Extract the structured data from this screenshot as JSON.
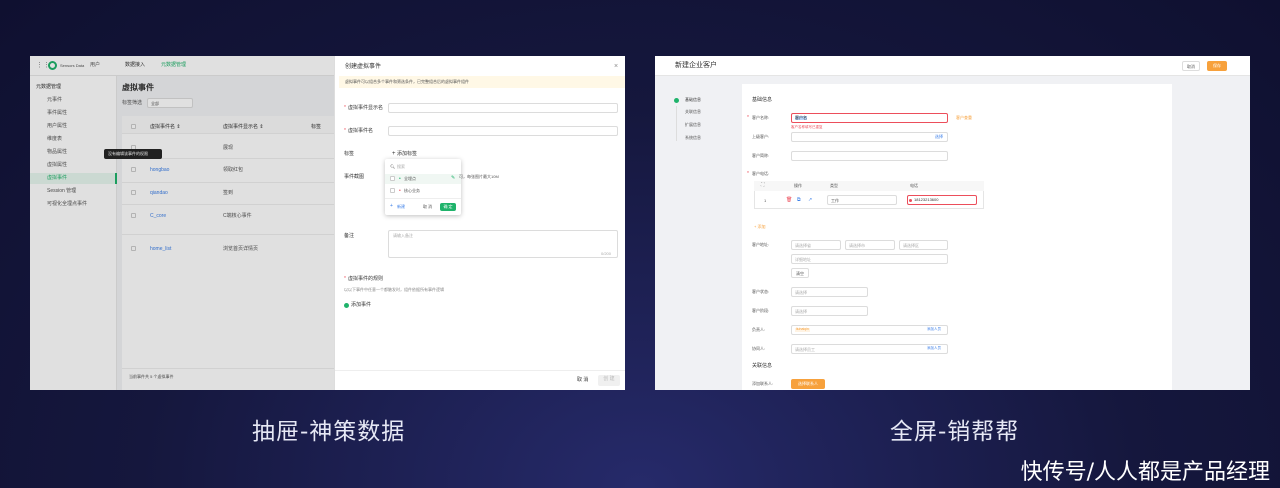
{
  "left": {
    "logo_brand": "Sensors Data",
    "top_menu": "用户",
    "nav_tabs": [
      "数据接入",
      "元数据管理"
    ],
    "sidebar_section": "元数据管理",
    "sidebar_items": [
      "元事件",
      "事件属性",
      "用户属性",
      "维度表",
      "物品属性",
      "虚拟属性",
      "虚拟事件",
      "Session 管理",
      "可视化全埋点事件"
    ],
    "page_title": "虚拟事件",
    "filter_label": "标签筛选",
    "filter_value": "全部",
    "columns": [
      "虚拟事件名 ⇕",
      "虚拟事件显示名 ⇕",
      "标签"
    ],
    "rows": [
      {
        "name": "",
        "display": "展现"
      },
      {
        "name": "hongbao",
        "display": "领取红包"
      },
      {
        "name": "qiandao",
        "display": "签到"
      },
      {
        "name": "C_core",
        "display": "C端核心事件"
      },
      {
        "name": "home_list",
        "display": "浏览首页详情页"
      }
    ],
    "tooltip": "没有编辑该事件的权限",
    "footer": "当前事件共 5 个虚拟事件",
    "drawer": {
      "title": "创建虚拟事件",
      "notice": "虚拟事件可以组合多个事件和筛选条件，已完整组合后的虚拟事件组件",
      "f1_label": "虚拟事件显示名",
      "f2_label": "虚拟事件名",
      "tag_label": "标签",
      "add_tag": "添加标签",
      "search": "搜索",
      "opt1": "全埋点",
      "opt2": "核心业务",
      "new_btn": "新建",
      "cancel": "取 消",
      "ok": "确 定",
      "shot_label": "事件截图",
      "shot_hint": "可，每张图片最大10M",
      "remark_label": "备注",
      "remark_ph": "请输入备注",
      "counter": "0/200",
      "rule_label": "虚拟事件的规则",
      "rule_hint": "以以下事件中任意一个都触发时，组件依据所有事件逻辑",
      "add_event": "添加事件",
      "foot_cancel": "取 消",
      "foot_ok": "创 建"
    }
  },
  "right": {
    "title": "新建企业客户",
    "btn_cancel": "取消",
    "btn_save": "保存",
    "steps": [
      "基础信息",
      "关联信息",
      "扩展信息",
      "系统信息"
    ],
    "section1": "基础信息",
    "customer_name_label": "客户名称:",
    "customer_name_value": "客户名",
    "customer_name_error": "客户名称填写已重复",
    "dup_check": "客户查重",
    "parent_label": "上级客户:",
    "select_link": "选择",
    "short_label": "客户简称:",
    "phone_label": "客户电话:",
    "table_cols": [
      "操作",
      "类型",
      "电话"
    ],
    "table_row": {
      "idx": "1",
      "type": "工作",
      "phone": "18123213600"
    },
    "add_link": "+ 添加",
    "addr_label": "客户地址:",
    "addr_selects": [
      "请选择省",
      "请选择市",
      "请选择区"
    ],
    "addr_detail": "详细地址",
    "addr_btn": "清空",
    "status_label": "客户状态:",
    "stage_label": "客户阶段:",
    "placeholder_select": "请选择",
    "owner_label": "负责人:",
    "owner_tag": "liuhaiqin",
    "add_person": "添加人员",
    "collab_label": "协同人:",
    "collab_ph": "请选择员工",
    "section2": "关联信息",
    "contact_label": "添加联系人:",
    "contact_btn": "选择联系人"
  },
  "captions": {
    "left": "抽屉-神策数据",
    "right": "全屏-销帮帮"
  },
  "watermark": "快传号/人人都是产品经理",
  "colors": {
    "accent_green": "#1fb36b",
    "accent_orange": "#f7a13c",
    "error_red": "#ec4e5b",
    "link_blue": "#3a7ee8"
  }
}
